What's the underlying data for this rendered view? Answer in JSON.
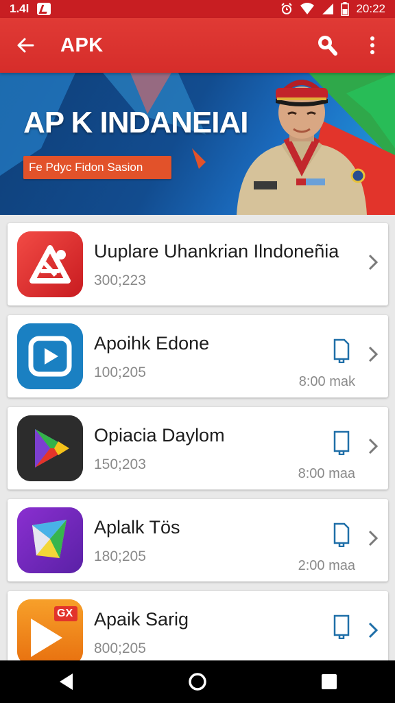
{
  "status_bar": {
    "left_text": "1.4l",
    "time": "20:22",
    "icons": [
      "notification-icon",
      "alarm-icon",
      "wifi-icon",
      "signal-icon",
      "battery-icon"
    ]
  },
  "app_bar": {
    "title": "APK",
    "icons": [
      "back-arrow-icon",
      "search-icon",
      "more-vert-icon"
    ]
  },
  "banner": {
    "title": "AP K INDANEIAI",
    "tag": "Fe Pdyc Fidon Sasion"
  },
  "apps": [
    {
      "name": "Uuplare Uhankrian Ilndoneñia",
      "count": "300;223",
      "time": "",
      "icon": "app-logo-red-triangle",
      "color": "#e0282c",
      "has_device_icon": false
    },
    {
      "name": "Apoihk Edone",
      "count": "100;205",
      "time": "8:00 mak",
      "icon": "play-square-icon",
      "color": "#1c7fc0",
      "has_device_icon": true
    },
    {
      "name": "Opiacia Daylom",
      "count": "150;203",
      "time": "8:00 maa",
      "icon": "play-store-icon",
      "color": "#2f2f2f",
      "has_device_icon": true
    },
    {
      "name": "Aplalk Tös",
      "count": "180;205",
      "time": "2:00 maa",
      "icon": "prism-icon",
      "color": "#7b2fbe",
      "has_device_icon": true
    },
    {
      "name": "Apaik Sarig",
      "count": "800;205",
      "time": "",
      "icon": "orange-play-icon",
      "color": "#f08a1c",
      "badge": "GX",
      "has_device_icon": true
    }
  ],
  "colors": {
    "primary": "#d62d2a",
    "status": "#c81e22",
    "accent_blue": "#1f6fa8"
  },
  "nav_bar": {
    "icons": [
      "nav-back-icon",
      "nav-home-icon",
      "nav-recents-icon"
    ]
  }
}
